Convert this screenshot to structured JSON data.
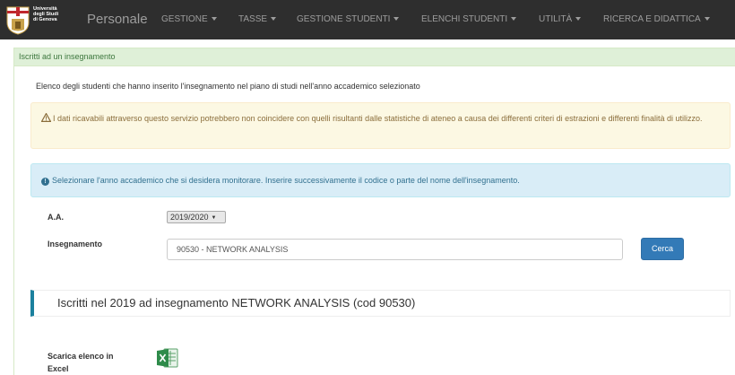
{
  "header": {
    "university_lines": [
      "Università",
      "degli Studi",
      "di Genova"
    ],
    "brand": "Personale",
    "nav": [
      {
        "label": "GESTIONE"
      },
      {
        "label": "TASSE"
      },
      {
        "label": "GESTIONE STUDENTI"
      },
      {
        "label": "ELENCHI STUDENTI"
      },
      {
        "label": "UTILITÀ"
      },
      {
        "label": "RICERCA E DIDATTICA"
      }
    ]
  },
  "panel": {
    "heading": "Iscritti ad un insegnamento",
    "intro": "Elenco degli studenti che hanno inserito l'insegnamento nel piano di studi nell'anno accademico selezionato",
    "warning": "I dati ricavabili attraverso questo servizio potrebbero non coincidere con quelli risultanti dalle statistiche di ateneo a causa dei differenti criteri di estrazioni e differenti finalità di utilizzo.",
    "info": "Selezionare l'anno accademico che si desidera monitorare. Inserire successivamente il codice o parte del nome dell'insegnamento."
  },
  "form": {
    "aa_label": "A.A.",
    "aa_value": "2019/2020",
    "course_label": "Insegnamento",
    "course_value": "90530 - NETWORK ANALYSIS",
    "search_button": "Cerca"
  },
  "result": {
    "title": "Iscritti nel 2019 ad insegnamento NETWORK ANALYSIS (cod 90530)",
    "excel_label": "Scarica elenco in Excel"
  },
  "colors": {
    "navbar": "#2e2e2e",
    "success_bg": "#dff0d8",
    "warning_bg": "#fcf8e3",
    "info_bg": "#d9edf7",
    "primary": "#337ab7",
    "accent_border": "#1b809e"
  },
  "icons": [
    "university-logo-icon",
    "warning-icon",
    "info-icon",
    "excel-icon",
    "caret-down-icon"
  ]
}
